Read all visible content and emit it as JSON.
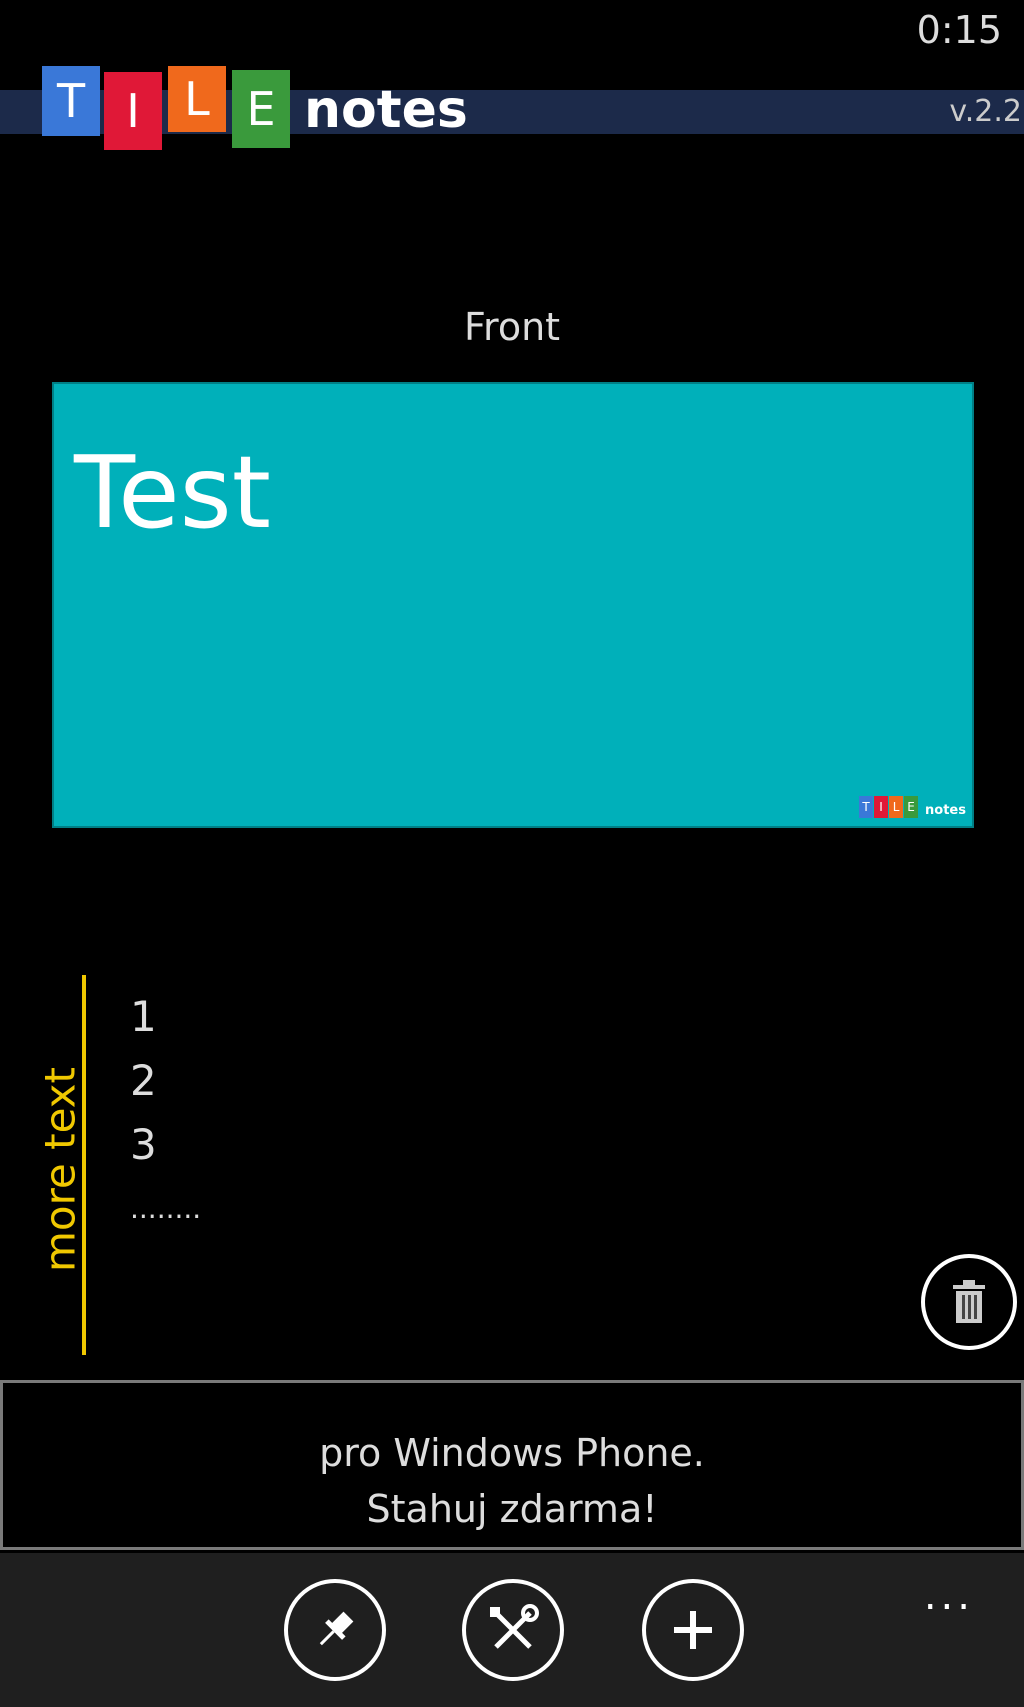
{
  "status": {
    "time": "0:15"
  },
  "header": {
    "logo_letters": [
      {
        "letter": "T",
        "color": "#3a78d8"
      },
      {
        "letter": "I",
        "color": "#e01837"
      },
      {
        "letter": "L",
        "color": "#f0691c"
      },
      {
        "letter": "E",
        "color": "#3a9a3c"
      }
    ],
    "logo_word": "notes",
    "version": "v.2.2"
  },
  "tile": {
    "section_label": "Front",
    "title": "Test",
    "color": "#00b0ba",
    "mini_logo_word": "notes"
  },
  "back": {
    "side_label": "more text",
    "lines": [
      "1",
      "2",
      "3",
      "........"
    ],
    "accent": "#f0c800"
  },
  "ad": {
    "line1": "pro Windows Phone.",
    "line2": "Stahuj zdarma!"
  },
  "appbar": {
    "buttons": [
      "pin-icon",
      "settings-icon",
      "add-icon",
      "delete-icon"
    ],
    "more": "..."
  }
}
